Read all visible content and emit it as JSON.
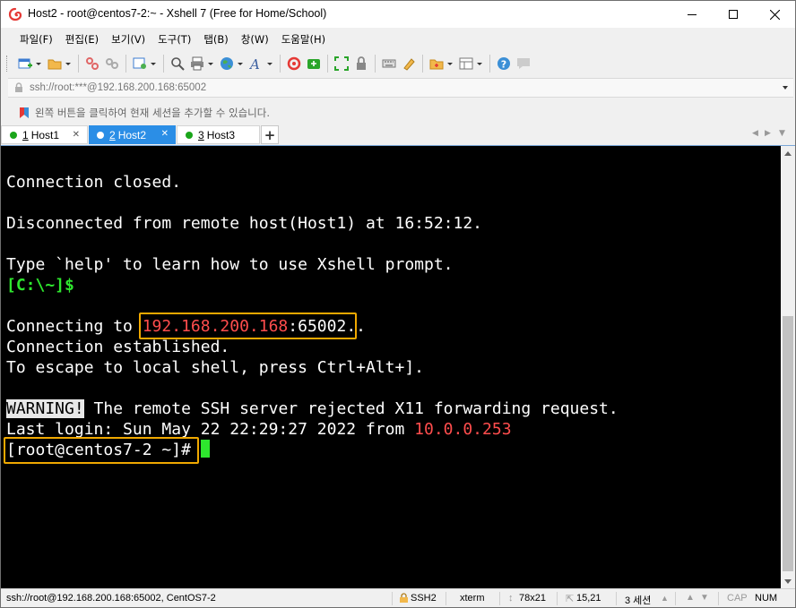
{
  "window": {
    "title": "Host2 - root@centos7-2:~ - Xshell 7 (Free for Home/School)",
    "controls": {
      "minimize": "—",
      "maximize": "☐",
      "close": "✕"
    }
  },
  "menu": {
    "items": [
      {
        "label": "파일(F)"
      },
      {
        "label": "편집(E)"
      },
      {
        "label": "보기(V)"
      },
      {
        "label": "도구(T)"
      },
      {
        "label": "탭(B)"
      },
      {
        "label": "창(W)"
      },
      {
        "label": "도움말(H)"
      }
    ]
  },
  "toolbar": {
    "icons": [
      "new-session-icon",
      "open-folder-icon",
      "disconnect-icon",
      "reconnect-icon",
      "properties-icon",
      "find-icon",
      "print-icon",
      "globe-icon",
      "font-icon",
      "xshell-icon",
      "xftp-icon",
      "fullscreen-icon",
      "lock-icon",
      "keyboard-icon",
      "highlight-icon",
      "transfer-icon",
      "layout-icon",
      "help-icon",
      "chat-icon"
    ]
  },
  "address": {
    "value": "ssh://root:***@192.168.200.168:65002"
  },
  "info": {
    "text": "왼쪽 버튼을 클릭하여 현재 세션을 추가할 수 있습니다."
  },
  "tabs": [
    {
      "num": "1",
      "label": "Host1",
      "active": false
    },
    {
      "num": "2",
      "label": "Host2",
      "active": true
    },
    {
      "num": "3",
      "label": "Host3",
      "active": false
    }
  ],
  "tab_controls": {
    "add": "+",
    "prev": "◀",
    "next": "▶",
    "menu": "▼"
  },
  "terminal": {
    "line1": "Connection closed.",
    "line2": "Disconnected from remote host(Host1) at 16:52:12.",
    "line3": "Type `help' to learn how to use Xshell prompt.",
    "prompt_local": "[C:\\~]$",
    "connecting_prefix": "Connecting to ",
    "connecting_ip": "192.168.200.168",
    "connecting_port": ":65002",
    "connecting_suffix": "..",
    "established": "Connection established.",
    "escape": "To escape to local shell, press Ctrl+Alt+].",
    "warning_tag": "WARNING!",
    "warning_text": " The remote SSH server rejected X11 forwarding request.",
    "last_login_prefix": "Last login: Sun May 22 22:29:27 2022 from ",
    "last_login_ip": "10.0.0.253",
    "remote_prompt": "[root@centos7-2 ~]#"
  },
  "status": {
    "connection": "ssh://root@192.168.200.168:65002, CentOS7-2",
    "protocol": "SSH2",
    "terminal": "xterm",
    "size": "78x21",
    "cursor_pos": "15,21",
    "sessions": "3 세션",
    "cap": "CAP",
    "num": "NUM"
  },
  "colors": {
    "tab_active": "#2b8ee6",
    "prompt_green": "#2ee62e",
    "ip_red": "#ff4d4d",
    "highlight_box": "#f0a800"
  }
}
